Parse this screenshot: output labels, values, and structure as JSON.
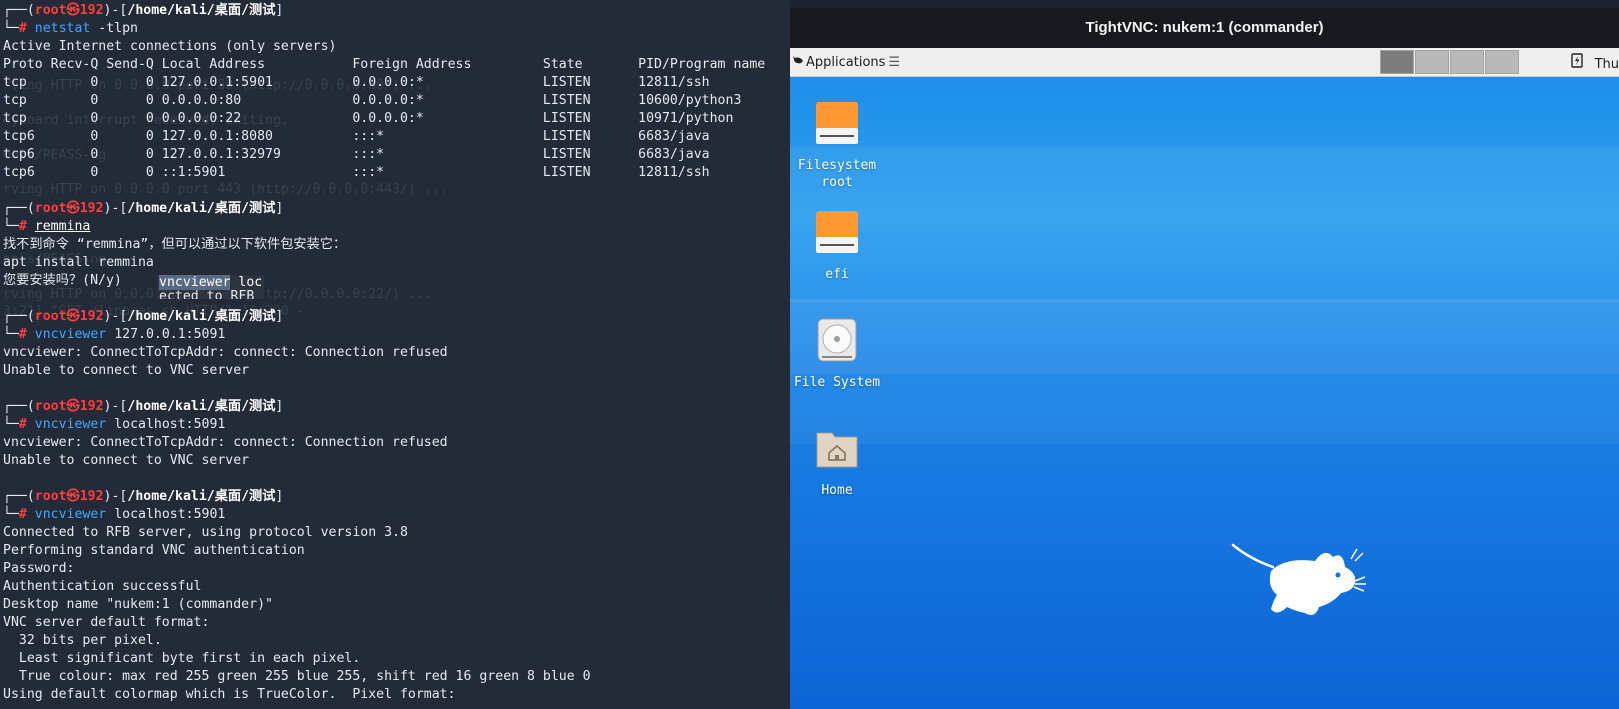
{
  "terminal": {
    "lines": [
      {
        "type": "prompt",
        "user": "root",
        "symbol": "㉿",
        "host": "192",
        "path": "/home/kali/桌面/测试"
      },
      {
        "type": "command",
        "cmd": "netstat",
        "args": " -tlpn",
        "underline": false
      },
      {
        "type": "text",
        "text": "Active Internet connections (only servers)"
      },
      {
        "type": "text",
        "text": "Proto Recv-Q Send-Q Local Address           Foreign Address         State       PID/Program name"
      },
      {
        "type": "text",
        "text": "tcp        0      0 127.0.0.1:5901          0.0.0.0:*               LISTEN      12811/ssh"
      },
      {
        "type": "text",
        "text": "tcp        0      0 0.0.0.0:80              0.0.0.0:*               LISTEN      10600/python3"
      },
      {
        "type": "text",
        "text": "tcp        0      0 0.0.0.0:22              0.0.0.0:*               LISTEN      10971/python"
      },
      {
        "type": "text",
        "text": "tcp6       0      0 127.0.0.1:8080          :::*                    LISTEN      6683/java"
      },
      {
        "type": "text",
        "text": "tcp6       0      0 127.0.0.1:32979         :::*                    LISTEN      6683/java"
      },
      {
        "type": "text",
        "text": "tcp6       0      0 ::1:5901                :::*                    LISTEN      12811/ssh"
      },
      {
        "type": "blank"
      },
      {
        "type": "prompt",
        "user": "root",
        "symbol": "㉿",
        "host": "192",
        "path": "/home/kali/桌面/测试"
      },
      {
        "type": "command",
        "cmd": "remmina",
        "args": "",
        "underline": true
      },
      {
        "type": "text",
        "text": "找不到命令 “remmina”，但可以通过以下软件包安装它："
      },
      {
        "type": "text",
        "text": "apt install remmina"
      },
      {
        "type": "text",
        "text": "您要安装吗？(N/y)"
      },
      {
        "type": "blank"
      },
      {
        "type": "prompt",
        "user": "root",
        "symbol": "㉿",
        "host": "192",
        "path": "/home/kali/桌面/测试"
      },
      {
        "type": "command",
        "cmd": "vncviewer",
        "args": " 127.0.0.1:5091",
        "underline": false
      },
      {
        "type": "text",
        "text": "vncviewer: ConnectToTcpAddr: connect: Connection refused"
      },
      {
        "type": "text",
        "text": "Unable to connect to VNC server"
      },
      {
        "type": "blank"
      },
      {
        "type": "prompt",
        "user": "root",
        "symbol": "㉿",
        "host": "192",
        "path": "/home/kali/桌面/测试"
      },
      {
        "type": "command",
        "cmd": "vncviewer",
        "args": " localhost:5091",
        "underline": false
      },
      {
        "type": "text",
        "text": "vncviewer: ConnectToTcpAddr: connect: Connection refused"
      },
      {
        "type": "text",
        "text": "Unable to connect to VNC server"
      },
      {
        "type": "blank"
      },
      {
        "type": "prompt",
        "user": "root",
        "symbol": "㉿",
        "host": "192",
        "path": "/home/kali/桌面/测试"
      },
      {
        "type": "command",
        "cmd": "vncviewer",
        "args": " localhost:5901",
        "underline": false
      },
      {
        "type": "text",
        "text": "Connected to RFB server, using protocol version 3.8"
      },
      {
        "type": "text",
        "text": "Performing standard VNC authentication"
      },
      {
        "type": "text",
        "text": "Password:"
      },
      {
        "type": "text",
        "text": "Authentication successful"
      },
      {
        "type": "text",
        "text": "Desktop name \"nukem:1 (commander)\""
      },
      {
        "type": "text",
        "text": "VNC server default format:"
      },
      {
        "type": "text",
        "text": "  32 bits per pixel."
      },
      {
        "type": "text",
        "text": "  Least significant byte first in each pixel."
      },
      {
        "type": "text",
        "text": "  True colour: max red 255 green 255 blue 255, shift red 16 green 8 blue 0"
      },
      {
        "type": "text",
        "text": "Using default colormap which is TrueColor.  Pixel format:"
      }
    ],
    "popup": {
      "line1_highlight": "vncviewer",
      "line1_rest": " loc",
      "line2": "ected to RFB"
    },
    "ghost_lines": [
      "rving HTTP on 0.0.0.0 port 80 (http://0.0.0.0:80/) ...",
      "eyboard interrupt received, exiting.",
      "ools/PEASS-ng",
      "rving HTTP on 0.0.0.0 port 443 (http://0.0.0.0:443/) ...",
      "ools/PEASS-ng",
      "rving HTTP on 0.0.0.0 port 22 (http://0.0.0.0:22/) ...",
      "3:21] \"GET /linpeas.sh HTTP/1.1\" 200 -"
    ],
    "colors": {
      "background": "#232a38",
      "prompt_frame": "#3f7fe6",
      "user_host": "#ff3d3d",
      "path": "#ffffff",
      "command": "#43a6ff",
      "output": "#e6e9ee"
    }
  },
  "vnc": {
    "window_title": "TightVNC: nukem:1 (commander)",
    "panel": {
      "applications_label": "Applications",
      "menu_sep_icon": "menu-separator-icon",
      "workspaces": [
        {
          "active": true
        },
        {
          "active": false
        },
        {
          "active": false
        },
        {
          "active": false
        }
      ],
      "clock_text": "Thu"
    },
    "desktop": {
      "icons": [
        {
          "label_line1": "Filesystem",
          "label_line2": "root",
          "icon": "drive-icon"
        },
        {
          "label_line1": "efi",
          "label_line2": "",
          "icon": "drive-icon"
        },
        {
          "label_line1": "File System",
          "label_line2": "",
          "icon": "harddisk-icon"
        },
        {
          "label_line1": "Home",
          "label_line2": "",
          "icon": "home-folder-icon"
        }
      ],
      "logo": "xfce-mouse-logo",
      "colors": {
        "top": "#1f8ee8",
        "bottom": "#0d64d4"
      }
    }
  }
}
